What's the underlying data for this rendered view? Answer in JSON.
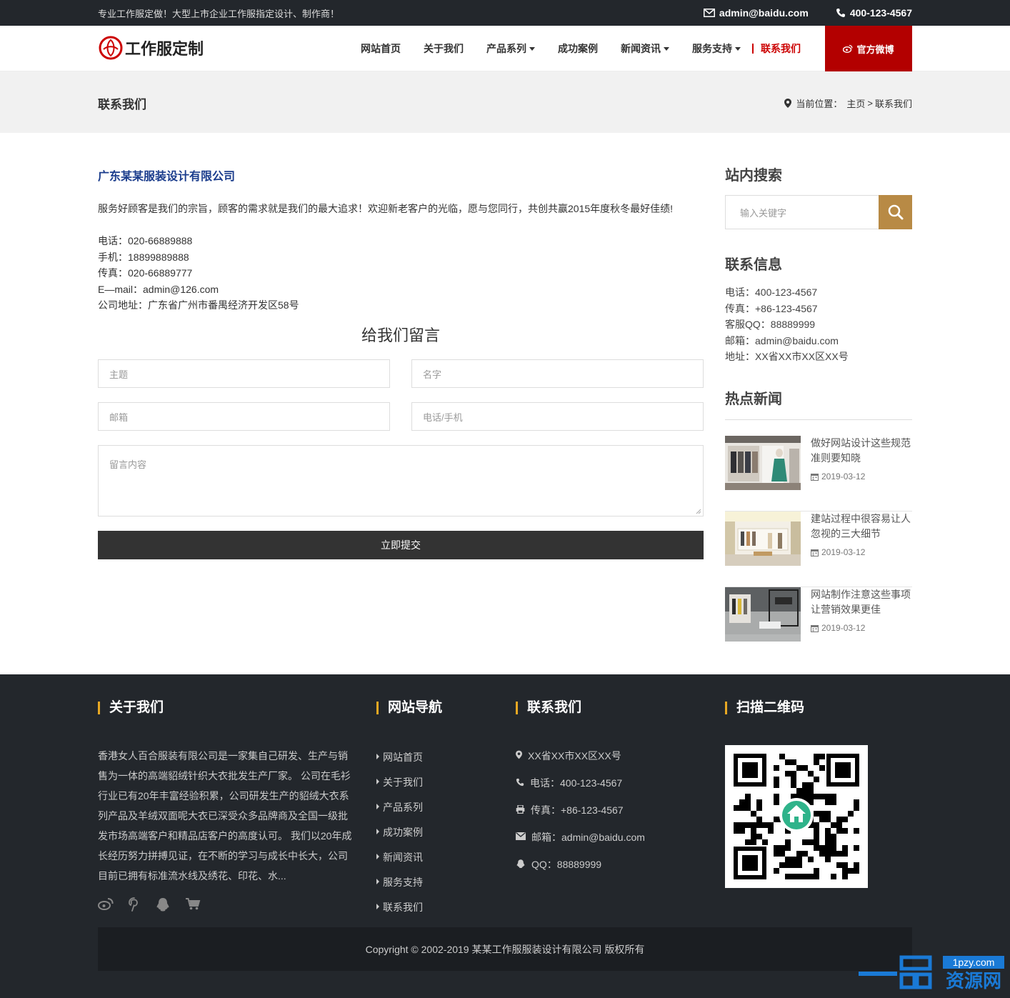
{
  "topbar": {
    "tagline": "专业工作服定做！大型上市企业工作服指定设计、制作商！",
    "email": "admin@baidu.com",
    "phone": "400-123-4567"
  },
  "header": {
    "logo_text": "工作服定制",
    "nav": [
      "网站首页",
      "关于我们",
      "产品系列",
      "成功案例",
      "新闻资讯",
      "服务支持",
      "联系我们"
    ],
    "weibo_button": "官方微博"
  },
  "pagebar": {
    "title": "联系我们",
    "crumb_prefix": "当前位置：",
    "crumb_home": "主页",
    "crumb_sep": ">",
    "crumb_current": "联系我们"
  },
  "main": {
    "company": "广东某某服装设计有限公司",
    "intro": "服务好顾客是我们的宗旨，顾客的需求就是我们的最大追求！欢迎新老客户的光临，愿与您同行，共创共赢2015年度秋冬最好佳绩!",
    "contact": [
      "电话：020-66889888",
      "手机：18899889888",
      "传真：020-66889777",
      "E—mail：admin@126.com",
      "公司地址：广东省广州市番禺经济开发区58号"
    ],
    "form_title": "给我们留言",
    "fields": {
      "subject": "主题",
      "name": "名字",
      "email": "邮箱",
      "phone": "电话/手机",
      "message": "留言内容"
    },
    "submit": "立即提交"
  },
  "sidebar": {
    "search_title": "站内搜索",
    "search_placeholder": "输入关键字",
    "info_title": "联系信息",
    "info": [
      "电话：400-123-4567",
      "传真：+86-123-4567",
      "客服QQ：88889999",
      "邮箱：admin@baidu.com",
      "地址：XX省XX市XX区XX号"
    ],
    "news_title": "热点新闻",
    "news": [
      {
        "title": "做好网站设计这些规范准则要知晓",
        "date": "2019-03-12"
      },
      {
        "title": "建站过程中很容易让人忽视的三大细节",
        "date": "2019-03-12"
      },
      {
        "title": "网站制作注意这些事项让营销效果更佳",
        "date": "2019-03-12"
      }
    ]
  },
  "footer": {
    "about_title": "关于我们",
    "about_text": "香港女人百合服装有限公司是一家集自己研发、生产与销售为一体的高端貂绒针织大衣批发生产厂家。 公司在毛衫行业已有20年丰富经验积累，公司研发生产的貂绒大衣系列产品及羊绒双面呢大衣已深受众多品牌商及全国一级批发市场高端客户和精品店客户的高度认可。 我们以20年成长经历努力拼搏见证，在不断的学习与成长中长大，公司目前已拥有标准流水线及绣花、印花、水...",
    "nav_title": "网站导航",
    "nav": [
      "网站首页",
      "关于我们",
      "产品系列",
      "成功案例",
      "新闻资讯",
      "服务支持",
      "联系我们"
    ],
    "contact_title": "联系我们",
    "contact": [
      "XX省XX市XX区XX号",
      "电话：400-123-4567",
      "传真：+86-123-4567",
      "邮箱：admin@baidu.com",
      "QQ：88889999"
    ],
    "qr_title": "扫描二维码",
    "copyright": "Copyright © 2002-2019 某某工作服服装设计有限公司 版权所有"
  },
  "watermark": {
    "site": "1pzy.com",
    "name": "资源网"
  },
  "colors": {
    "accent": "#b30000",
    "topbar": "#23272c",
    "search_btn": "#b88a45",
    "footer_bar": "#e8a823",
    "company": "#1a3c8c"
  },
  "icons": [
    "envelope-icon",
    "phone-icon",
    "weibo-icon",
    "map-marker-icon",
    "search-icon",
    "calendar-icon",
    "fax-icon",
    "qq-icon",
    "pinterest-icon",
    "cart-icon"
  ]
}
